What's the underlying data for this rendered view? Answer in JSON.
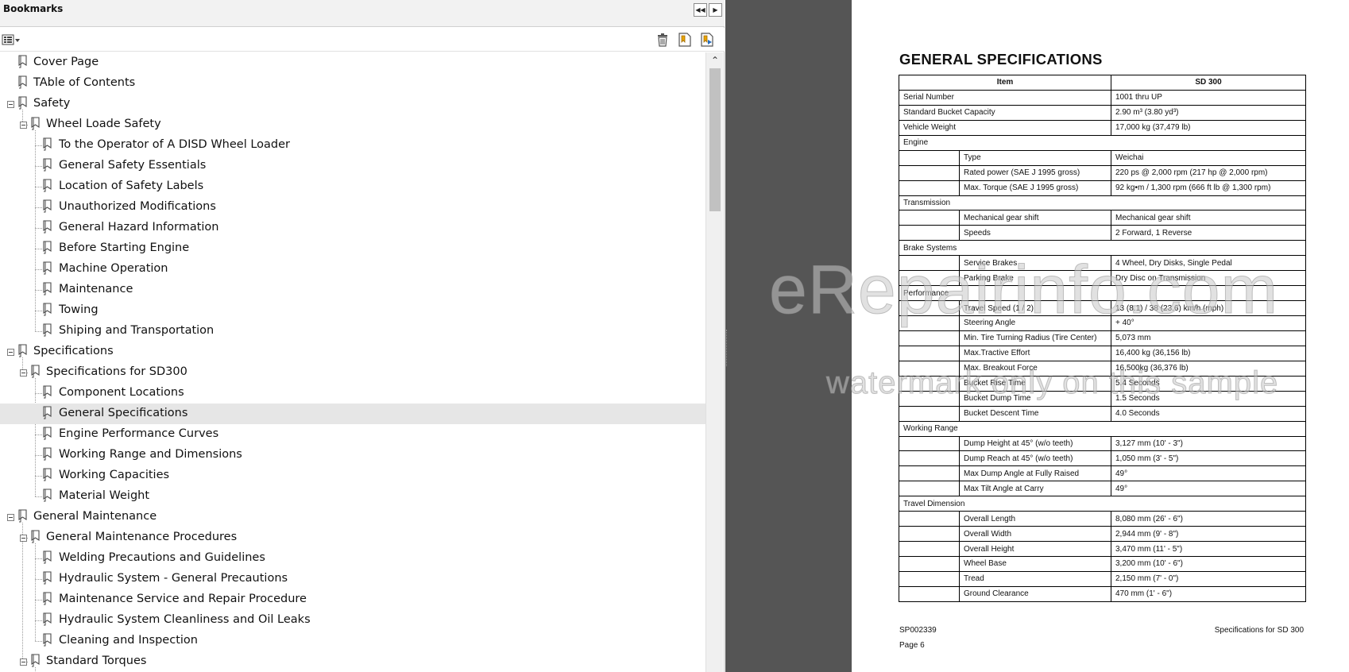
{
  "bookmarks_panel": {
    "title": "Bookmarks",
    "collapse_icon": "double-chevron-left-icon",
    "expand_icon": "chevron-right-icon",
    "options_icon": "options-menu-icon",
    "delete_icon": "trash-icon",
    "new_bookmark_icon": "new-bookmark-icon",
    "expand_bookmark_icon": "expand-bookmark-icon",
    "scroll_up_label": "⌃",
    "items": [
      {
        "label": "Cover Page",
        "level": 0,
        "has_children": false
      },
      {
        "label": "TAble of Contents",
        "level": 0,
        "has_children": false
      },
      {
        "label": "Safety",
        "level": 0,
        "has_children": true
      },
      {
        "label": "Wheel Loade Safety",
        "level": 1,
        "has_children": true
      },
      {
        "label": "To the Operator of A DISD Wheel Loader",
        "level": 2,
        "has_children": false
      },
      {
        "label": "General Safety Essentials",
        "level": 2,
        "has_children": false
      },
      {
        "label": "Location of Safety Labels",
        "level": 2,
        "has_children": false
      },
      {
        "label": "Unauthorized Modifications",
        "level": 2,
        "has_children": false
      },
      {
        "label": "General Hazard Information",
        "level": 2,
        "has_children": false
      },
      {
        "label": "Before Starting Engine",
        "level": 2,
        "has_children": false
      },
      {
        "label": "Machine Operation",
        "level": 2,
        "has_children": false
      },
      {
        "label": "Maintenance",
        "level": 2,
        "has_children": false
      },
      {
        "label": "Towing",
        "level": 2,
        "has_children": false
      },
      {
        "label": "Shiping and Transportation",
        "level": 2,
        "has_children": false
      },
      {
        "label": "Specifications",
        "level": 0,
        "has_children": true
      },
      {
        "label": "Specifications for SD300",
        "level": 1,
        "has_children": true
      },
      {
        "label": "Component Locations",
        "level": 2,
        "has_children": false
      },
      {
        "label": "General Specifications",
        "level": 2,
        "has_children": false,
        "selected": true
      },
      {
        "label": "Engine Performance Curves",
        "level": 2,
        "has_children": false
      },
      {
        "label": "Working Range and Dimensions",
        "level": 2,
        "has_children": false
      },
      {
        "label": "Working Capacities",
        "level": 2,
        "has_children": false
      },
      {
        "label": "Material Weight",
        "level": 2,
        "has_children": false
      },
      {
        "label": "General Maintenance",
        "level": 0,
        "has_children": true
      },
      {
        "label": "General Maintenance Procedures",
        "level": 1,
        "has_children": true
      },
      {
        "label": "Welding Precautions and Guidelines",
        "level": 2,
        "has_children": false
      },
      {
        "label": "Hydraulic System - General Precautions",
        "level": 2,
        "has_children": false
      },
      {
        "label": "Maintenance Service and Repair Procedure",
        "level": 2,
        "has_children": false
      },
      {
        "label": "Hydraulic System Cleanliness and Oil Leaks",
        "level": 2,
        "has_children": false
      },
      {
        "label": "Cleaning and Inspection",
        "level": 2,
        "has_children": false
      },
      {
        "label": "Standard Torques",
        "level": 1,
        "has_children": true
      }
    ]
  },
  "document": {
    "heading": "GENERAL SPECIFICATIONS",
    "table_headers": [
      "Item",
      "SD 300"
    ],
    "rows": [
      {
        "type": "full",
        "item": "Serial Number",
        "value": "1001 thru UP"
      },
      {
        "type": "full",
        "item": "Standard Bucket Capacity",
        "value": "2.90 m³ (3.80 yd³)"
      },
      {
        "type": "full",
        "item": "Vehicle Weight",
        "value": "17,000 kg (37,479 lb)"
      },
      {
        "type": "section",
        "item": "Engine"
      },
      {
        "type": "sub",
        "item": "Type",
        "value": "Weichai"
      },
      {
        "type": "sub",
        "item": "Rated power (SAE J 1995 gross)",
        "value": "220 ps @ 2,000 rpm (217 hp @ 2,000 rpm)"
      },
      {
        "type": "sub",
        "item": "Max. Torque (SAE J 1995 gross)",
        "value": "92 kg•m / 1,300 rpm (666 ft lb @ 1,300 rpm)"
      },
      {
        "type": "section",
        "item": "Transmission"
      },
      {
        "type": "sub",
        "item": "Mechanical gear shift",
        "value": "Mechanical  gear  shift"
      },
      {
        "type": "sub",
        "item": "Speeds",
        "value": "2 Forward, 1 Reverse"
      },
      {
        "type": "section",
        "item": "Brake Systems"
      },
      {
        "type": "sub",
        "item": "Service Brakes",
        "value": "4 Wheel, Dry Disks, Single Pedal"
      },
      {
        "type": "sub",
        "item": "Parking Brake",
        "value": "Dry Disc on Transmission"
      },
      {
        "type": "section",
        "item": "Performance"
      },
      {
        "type": "sub",
        "item": "Travel Speed (1 / 2)",
        "value": "13 (8.1) / 38 (23.6) km/h (mph)"
      },
      {
        "type": "sub",
        "item": "Steering Angle",
        "value": "+ 40°"
      },
      {
        "type": "sub",
        "item": "Min. Tire Turning Radius (Tire Center)",
        "value": "5,073 mm"
      },
      {
        "type": "sub",
        "item": "Max.Tractive Effort",
        "value": "16,400 kg (36,156 lb)"
      },
      {
        "type": "sub",
        "item": "Max. Breakout Force",
        "value": "16,500kg (36,376 lb)"
      },
      {
        "type": "sub",
        "item": "Bucket Rise Time",
        "value": "5.4 Seconds"
      },
      {
        "type": "sub",
        "item": "Bucket Dump Time",
        "value": "1.5 Seconds"
      },
      {
        "type": "sub",
        "item": "Bucket Descent Time",
        "value": "4.0 Seconds"
      },
      {
        "type": "section",
        "item": "Working Range"
      },
      {
        "type": "sub",
        "item": "Dump Height at 45° (w/o teeth)",
        "value": "3,127 mm (10' - 3\")"
      },
      {
        "type": "sub",
        "item": "Dump Reach at 45° (w/o teeth)",
        "value": "1,050 mm (3' - 5\")"
      },
      {
        "type": "sub",
        "item": "Max Dump Angle at Fully Raised",
        "value": "49°"
      },
      {
        "type": "sub",
        "item": "Max Tilt Angle at Carry",
        "value": "49°"
      },
      {
        "type": "section",
        "item": "Travel Dimension"
      },
      {
        "type": "sub",
        "item": "Overall Length",
        "value": "8,080  mm (26' - 6\")"
      },
      {
        "type": "sub",
        "item": "Overall Width",
        "value": "2,944  mm (9' - 8\")"
      },
      {
        "type": "sub",
        "item": "Overall Height",
        "value": "3,470 mm (11' - 5\")"
      },
      {
        "type": "sub",
        "item": "Wheel Base",
        "value": "3,200 mm (10' - 6\")"
      },
      {
        "type": "sub",
        "item": "Tread",
        "value": "2,150 mm (7' - 0\")"
      },
      {
        "type": "sub",
        "item": "Ground Clearance",
        "value": "470 mm (1' - 6\")"
      }
    ],
    "footer": {
      "doc_number": "SP002339",
      "page_label": "Page 6",
      "section_title": "Specifications for SD 300"
    },
    "watermark": {
      "line1": "eRepairinfo.com",
      "line2": "watermark only on this sample"
    }
  }
}
